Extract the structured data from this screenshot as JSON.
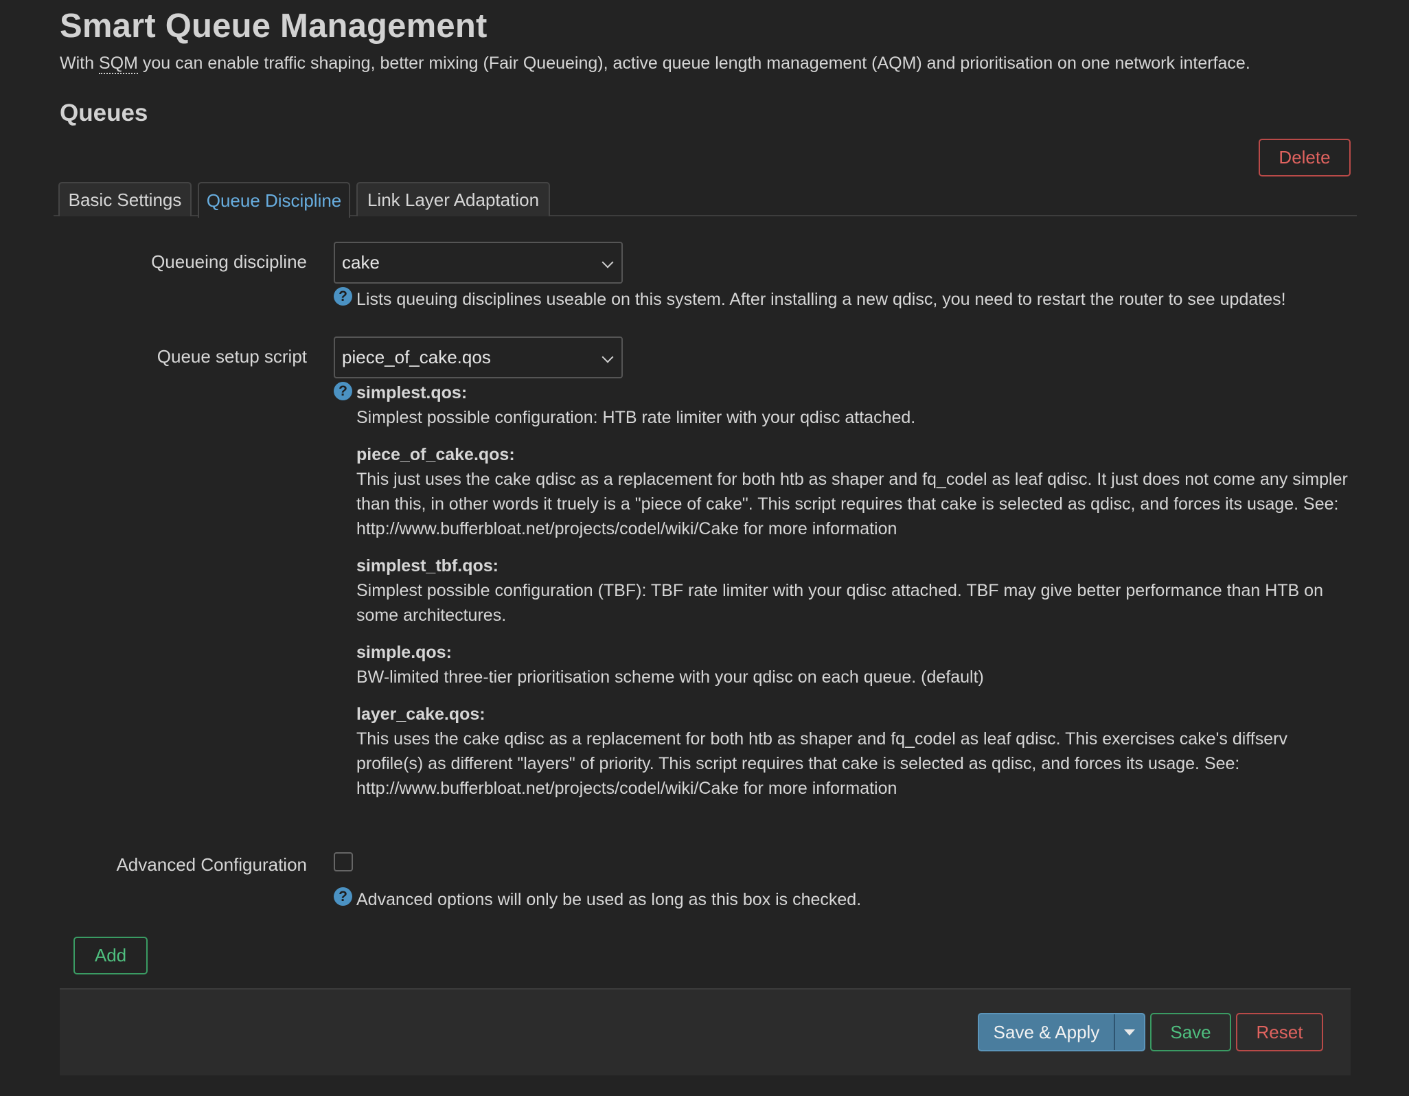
{
  "header": {
    "title": "Smart Queue Management",
    "description_prefix": "With ",
    "description_abbr": "SQM",
    "description_suffix": " you can enable traffic shaping, better mixing (Fair Queueing), active queue length management (AQM) and prioritisation on one network interface."
  },
  "section": {
    "title": "Queues",
    "delete_label": "Delete"
  },
  "tabs": [
    {
      "label": "Basic Settings",
      "active": false
    },
    {
      "label": "Queue Discipline",
      "active": true
    },
    {
      "label": "Link Layer Adaptation",
      "active": false
    }
  ],
  "fields": {
    "qdisc": {
      "label": "Queueing discipline",
      "value": "cake",
      "help": "Lists queuing disciplines useable on this system. After installing a new qdisc, you need to restart the router to see updates!"
    },
    "script": {
      "label": "Queue setup script",
      "value": "piece_of_cake.qos",
      "help_items": [
        {
          "name": "simplest.qos:",
          "desc": "Simplest possible configuration: HTB rate limiter with your qdisc attached."
        },
        {
          "name": "piece_of_cake.qos:",
          "desc": "This just uses the cake qdisc as a replacement for both htb as shaper and fq_codel as leaf qdisc. It just does not come any simpler than this, in other words it truely is a \"piece of cake\". This script requires that cake is selected as qdisc, and forces its usage. See: http://www.bufferbloat.net/projects/codel/wiki/Cake for more information"
        },
        {
          "name": "simplest_tbf.qos:",
          "desc": "Simplest possible configuration (TBF): TBF rate limiter with your qdisc attached. TBF may give better performance than HTB on some architectures."
        },
        {
          "name": "simple.qos:",
          "desc": "BW-limited three-tier prioritisation scheme with your qdisc on each queue. (default)"
        },
        {
          "name": "layer_cake.qos:",
          "desc": "This uses the cake qdisc as a replacement for both htb as shaper and fq_codel as leaf qdisc. This exercises cake's diffserv profile(s) as different \"layers\" of priority. This script requires that cake is selected as qdisc, and forces its usage. See: http://www.bufferbloat.net/projects/codel/wiki/Cake for more information"
        }
      ]
    },
    "advanced": {
      "label": "Advanced Configuration",
      "checked": false,
      "help": "Advanced options will only be used as long as this box is checked."
    }
  },
  "add_label": "Add",
  "footer": {
    "save_apply_label": "Save & Apply",
    "save_label": "Save",
    "reset_label": "Reset"
  },
  "icons": {
    "help": "help-icon",
    "select_chevron": "chevron-down-icon",
    "dropdown_caret": "caret-down-icon"
  },
  "colors": {
    "background": "#232323",
    "accent_blue": "#68aee0",
    "danger": "#e0635f",
    "success": "#4fbf7f",
    "primary_button": "#4a7d9e"
  }
}
